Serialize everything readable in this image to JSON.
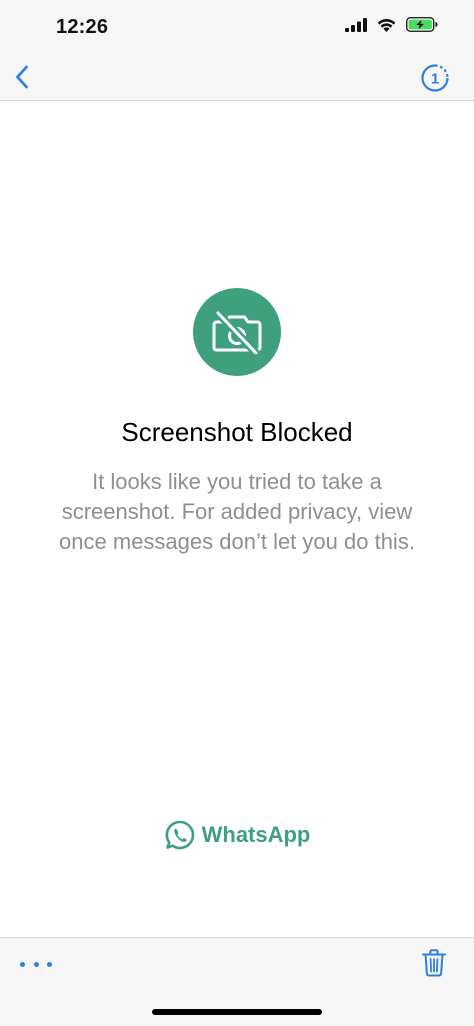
{
  "status_bar": {
    "time": "12:26",
    "icons": [
      "signal-icon",
      "wifi-icon",
      "battery-charging-icon"
    ]
  },
  "nav": {
    "back_icon": "chevron-left-icon",
    "view_once_label": "1"
  },
  "main": {
    "icon": "camera-blocked-icon",
    "title": "Screenshot Blocked",
    "message": "It looks like you tried to take a screenshot. For added privacy, view once messages don’t let you do this."
  },
  "brand": {
    "name": "WhatsApp",
    "icon": "whatsapp-logo-icon"
  },
  "toolbar": {
    "more_icon": "more-dots-icon",
    "delete_icon": "trash-icon"
  },
  "colors": {
    "accent_green": "#3fa07d",
    "ios_blue": "#2f7fe0",
    "bar_background": "#f6f6f7",
    "message_gray": "#8e8e93",
    "battery_green": "#4cd964"
  }
}
